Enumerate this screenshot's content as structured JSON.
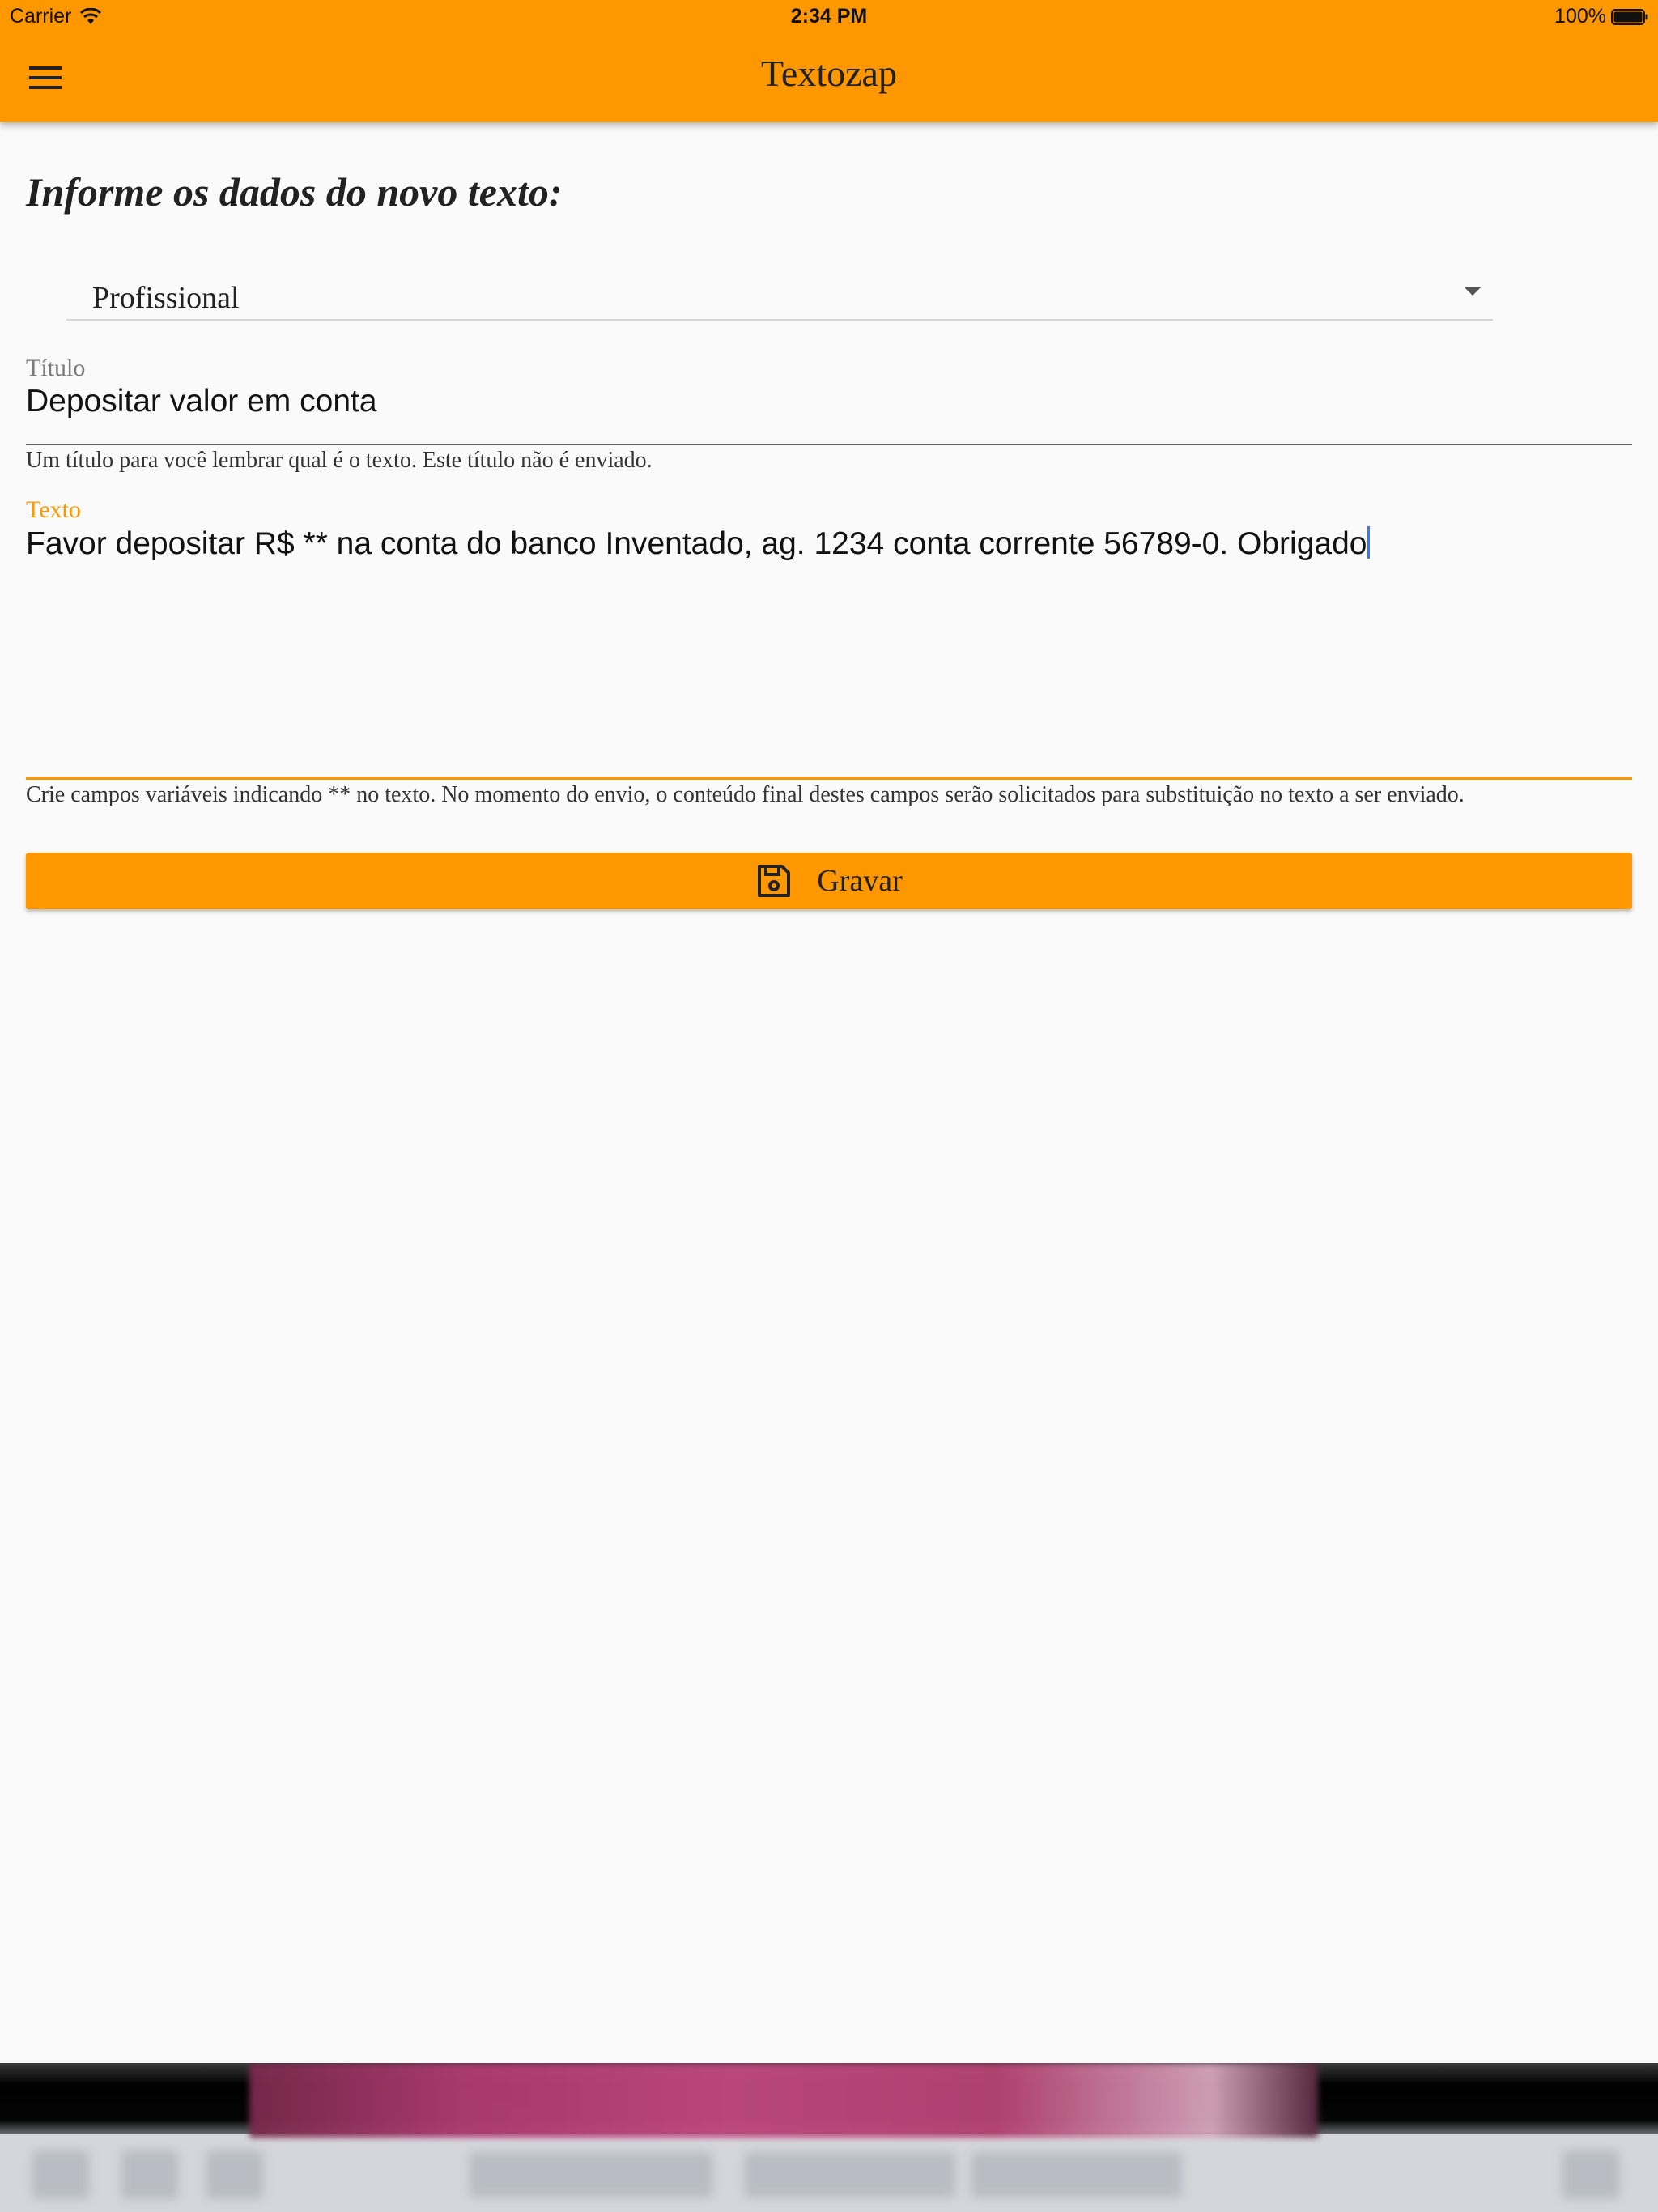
{
  "status_bar": {
    "carrier": "Carrier",
    "time": "2:34 PM",
    "battery": "100%"
  },
  "app_bar": {
    "title": "Textozap",
    "menu_icon": "hamburger-menu-icon"
  },
  "form": {
    "heading": "Informe os dados do novo texto:",
    "category": {
      "selected": "Profissional"
    },
    "titulo": {
      "label": "Título",
      "value": "Depositar valor em conta",
      "helper": "Um título para você lembrar qual é o texto. Este título não é enviado."
    },
    "texto": {
      "label": "Texto",
      "value": "Favor depositar R$ ** na conta do banco Inventado, ag. 1234 conta corrente 56789-0. Obrigado",
      "helper": "Crie campos variáveis indicando ** no texto. No momento do envio, o conteúdo final destes campos serão solicitados para substituição no texto a ser enviado."
    },
    "save_button": {
      "label": "Gravar",
      "icon": "floppy-disk-icon"
    }
  },
  "colors": {
    "accent": "#ff9800",
    "background": "#fafafa",
    "cursor": "#2f7cf6"
  }
}
